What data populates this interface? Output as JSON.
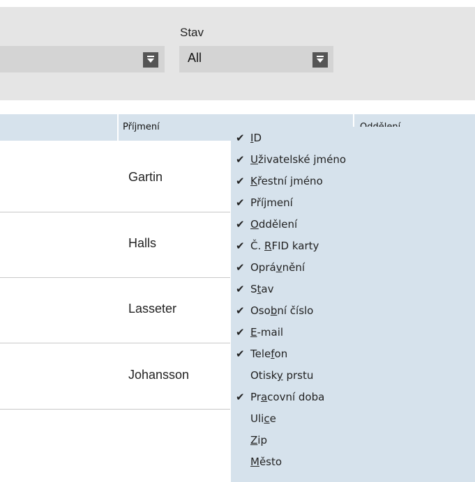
{
  "filters": {
    "first_select_value": "",
    "status_label": "Stav",
    "status_value": "All"
  },
  "table": {
    "headers": [
      "Příjmení",
      "Oddělení"
    ],
    "rows": [
      {
        "surname": "Gartin"
      },
      {
        "surname": "Halls"
      },
      {
        "surname": "Lasseter"
      },
      {
        "surname": "Johansson"
      }
    ]
  },
  "column_menu": {
    "check_glyph": "✔",
    "items": [
      {
        "pre": "",
        "u": "I",
        "post": "D",
        "checked": true
      },
      {
        "pre": "",
        "u": "U",
        "post": "živatelské jméno",
        "checked": true
      },
      {
        "pre": "",
        "u": "K",
        "post": "řestní jméno",
        "checked": true
      },
      {
        "pre": "Příjmení",
        "u": "",
        "post": "",
        "checked": true
      },
      {
        "pre": "",
        "u": "O",
        "post": "ddělení",
        "checked": true
      },
      {
        "pre": "Č. ",
        "u": "R",
        "post": "FID karty",
        "checked": true
      },
      {
        "pre": "Oprá",
        "u": "v",
        "post": "nění",
        "checked": true
      },
      {
        "pre": "S",
        "u": "t",
        "post": "av",
        "checked": true
      },
      {
        "pre": "Oso",
        "u": "b",
        "post": "ní číslo",
        "checked": true
      },
      {
        "pre": "",
        "u": "E",
        "post": "-mail",
        "checked": true
      },
      {
        "pre": "Tele",
        "u": "f",
        "post": "on",
        "checked": true
      },
      {
        "pre": "Otisk",
        "u": "y",
        "post": " prstu",
        "checked": false
      },
      {
        "pre": "Pr",
        "u": "a",
        "post": "covní doba",
        "checked": true
      },
      {
        "pre": "Uli",
        "u": "c",
        "post": "e",
        "checked": false
      },
      {
        "pre": "",
        "u": "Z",
        "post": "ip",
        "checked": false
      },
      {
        "pre": "",
        "u": "M",
        "post": "ěsto",
        "checked": false
      }
    ]
  }
}
